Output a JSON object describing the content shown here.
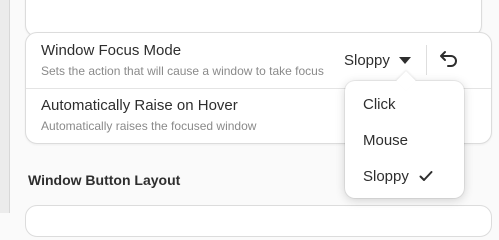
{
  "settings": {
    "focus_mode": {
      "title": "Window Focus Mode",
      "subtitle": "Sets the action that will cause a window to take focus",
      "selected": "Sloppy"
    },
    "raise_on_hover": {
      "title": "Automatically Raise on Hover",
      "subtitle": "Automatically raises the focused window"
    },
    "button_layout_heading": "Window Button Layout"
  },
  "dropdown": {
    "options": [
      {
        "label": "Click",
        "checked": false
      },
      {
        "label": "Mouse",
        "checked": false
      },
      {
        "label": "Sloppy",
        "checked": true
      }
    ]
  },
  "icons": {
    "dropdown": "chevron-down-icon",
    "reset": "undo-icon",
    "check": "check-icon"
  }
}
